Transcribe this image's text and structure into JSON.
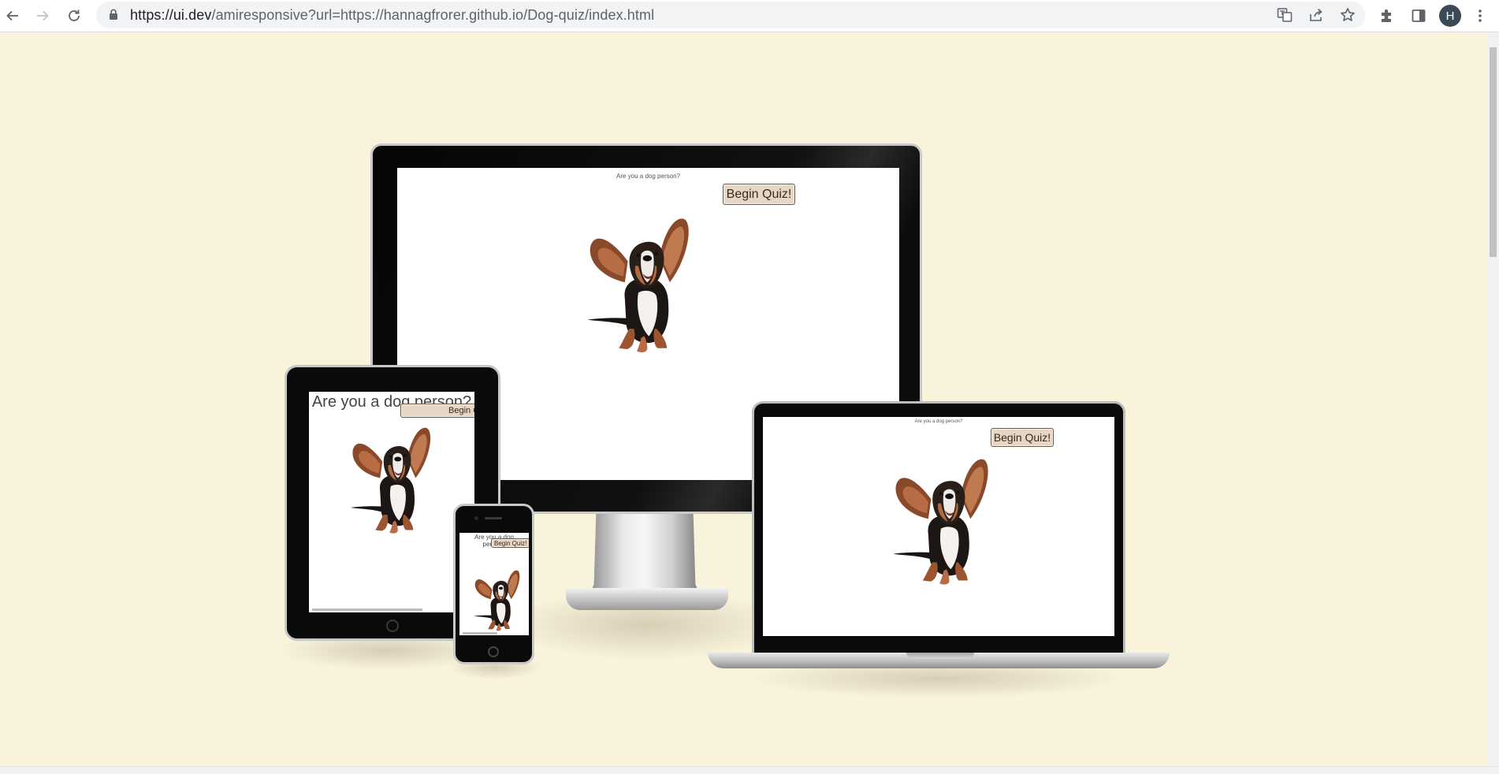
{
  "browser": {
    "url_host": "https://ui.dev",
    "url_rest": "/amiresponsive?url=https://hannagfrorer.github.io/Dog-quiz/index.html",
    "profile_initial": "H"
  },
  "site": {
    "title": "Are you a dog person?",
    "button_label": "Begin Quiz!",
    "tablet_title": "Are you a dog person?",
    "tablet_button": "Begin Quiz!",
    "phone_title": "Are you a dog person?",
    "phone_button": "Begin Quiz!"
  },
  "colors": {
    "page_background": "#faf3dc",
    "button_background": "#e6d6c6"
  },
  "icons": [
    "back-icon",
    "forward-icon",
    "reload-icon",
    "lock-icon",
    "translate-icon",
    "share-icon",
    "star-icon",
    "extensions-icon",
    "side-panel-icon",
    "menu-icon"
  ]
}
